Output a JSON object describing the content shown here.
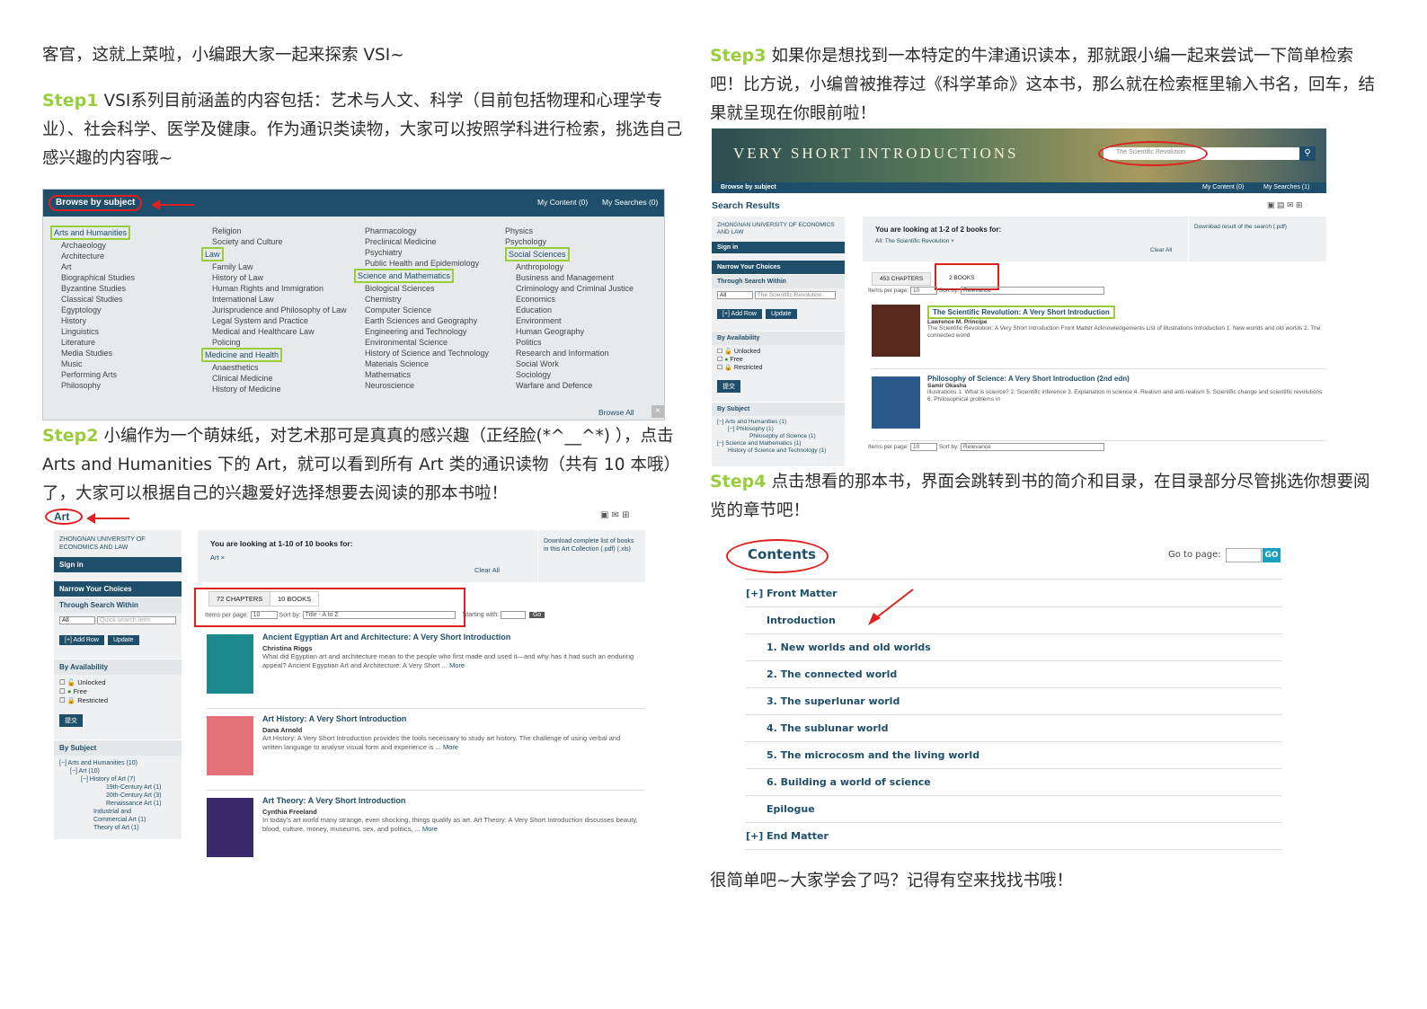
{
  "intro": "客官，这就上菜啦，小编跟大家一起来探索 VSI~",
  "step1": {
    "label": "Step1",
    "text": "VSI系列目前涵盖的内容包括：艺术与人文、科学（目前包括物理和心理学专业）、社会科学、医学及健康。作为通识类读物，大家可以按照学科进行检索，挑选自己感兴趣的内容哦~"
  },
  "step2": {
    "label": "Step2",
    "text": "小编作为一个萌妹纸，对艺术那可是真真的感兴趣（正经脸(*^__^*) ），点击 Arts and Humanities 下的 Art，就可以看到所有 Art 类的通识读物（共有 10 本哦）了，大家可以根据自己的兴趣爱好选择想要去阅读的那本书啦！"
  },
  "step3": {
    "label": "Step3",
    "text": "如果你是想找到一本特定的牛津通识读本，那就跟小编一起来尝试一下简单检索吧！比方说，小编曾被推荐过《科学革命》这本书，那么就在检索框里输入书名，回车，结果就呈现在你眼前啦！"
  },
  "step4": {
    "label": "Step4",
    "text": "点击想看的那本书，界面会跳转到书的简介和目录，在目录部分尽管挑选你想要阅览的章节吧！"
  },
  "outro": "很简单吧~大家学会了吗？记得有空来找找书哦！",
  "browse": {
    "button": "Browse by subject",
    "my_content": "My Content (0)",
    "my_searches": "My Searches (0)",
    "browse_all": "Browse All",
    "columns": [
      [
        "Arts and Humanities",
        "Archaeology",
        "Architecture",
        "Art",
        "Biographical Studies",
        "Byzantine Studies",
        "Classical Studies",
        "Egyptology",
        "History",
        "Linguistics",
        "Literature",
        "Media Studies",
        "Music",
        "Performing Arts",
        "Philosophy"
      ],
      [
        "Religion",
        "Society and Culture",
        "Law",
        "Family Law",
        "History of Law",
        "Human Rights and Immigration",
        "International Law",
        "Jurisprudence and Philosophy of Law",
        "Legal System and Practice",
        "Medical and Healthcare Law",
        "Policing",
        "Medicine and Health",
        "Anaesthetics",
        "Clinical Medicine",
        "History of Medicine"
      ],
      [
        "Pharmacology",
        "Preclinical Medicine",
        "Psychiatry",
        "Public Health and Epidemiology",
        "Science and Mathematics",
        "Biological Sciences",
        "Chemistry",
        "Computer Science",
        "Earth Sciences and Geography",
        "Engineering and Technology",
        "Environmental Science",
        "History of Science and Technology",
        "Materials Science",
        "Mathematics",
        "Neuroscience"
      ],
      [
        "Physics",
        "Psychology",
        "Social Sciences",
        "Anthropology",
        "Business and Management",
        "Criminology and Criminal Justice",
        "Economics",
        "Education",
        "Environment",
        "Human Geography",
        "Politics",
        "Research and Information",
        "Social Work",
        "Sociology",
        "Warfare and Defence"
      ]
    ]
  },
  "art_page": {
    "heading": "Art",
    "institution": "ZHONGNAN UNIVERSITY OF ECONOMICS AND LAW",
    "sign_in": "Sign in",
    "narrow": "Narrow Your Choices",
    "through_search": "Through Search Within",
    "all_option": "All",
    "quick_search_placeholder": "Quick search term",
    "add_row": "[+] Add Row",
    "update": "Update",
    "by_availability": "By Availability",
    "unlocked": "Unlocked",
    "free": "Free",
    "restricted": "Restricted",
    "submit": "提交",
    "by_subject": "By Subject",
    "subject_tree": [
      "[−] Arts and Humanities (10)",
      "[−] Art (10)",
      "[−] History of Art (7)",
      "19th-Century Art (1)",
      "20th-Century Art (3)",
      "Renaissance Art (1)",
      "Industrial and",
      "Commercial Art (1)",
      "Theory of Art (1)"
    ],
    "looking_at": "You are looking at  1-10 of 10 books  for:",
    "filter": "Art  ×",
    "clear_all": "Clear All",
    "download": "Download complete list of books in this Art Collection (.pdf) (.xls)",
    "tab_chapters": "72 CHAPTERS",
    "tab_books": "10 BOOKS",
    "items_per_page_label": "Items per page:",
    "items_per_page": "10",
    "sort_by_label": "Sort by:",
    "sort_by": "Title - A to Z",
    "starting_with": "Starting with:",
    "go": "Go",
    "books": [
      {
        "title": "Ancient Egyptian Art and Architecture: A Very Short Introduction",
        "author": "Christina Riggs",
        "desc": "What did Egyptian art and architecture mean to the people who first made and used it—and why has it had such an enduring appeal? Ancient Egyptian Art and Architecture: A Very Short ...",
        "more": "More",
        "cover": "#1c8a8c"
      },
      {
        "title": "Art History: A Very Short Introduction",
        "author": "Dana Arnold",
        "desc": "Art History: A Very Short Introduction provides the tools necessary to study art history. The challenge of using verbal and written language to analyse visual form and experience is ...",
        "more": "More",
        "cover": "#e4707a"
      },
      {
        "title": "Art Theory: A Very Short Introduction",
        "author": "Cynthia Freeland",
        "desc": "In today's art world many strange, even shocking, things qualify as art. Art Theory: A Very Short Introduction discusses beauty, blood, culture, money, museums, sex, and politics, ...",
        "more": "More",
        "cover": "#3b2a6b"
      }
    ]
  },
  "search_page": {
    "banner": "VERY SHORT INTRODUCTIONS",
    "search_value": "The Scientific Revolution",
    "browse": "Browse by subject",
    "my_content": "My Content (0)",
    "my_searches": "My Searches (1)",
    "results_heading": "Search Results",
    "institution": "ZHONGNAN UNIVERSITY OF ECONOMICS AND LAW",
    "sign_in": "Sign in",
    "narrow": "Narrow Your Choices",
    "through_search": "Through Search Within",
    "all_option": "All",
    "search_within_value": "The Scientific Revolution",
    "add_row": "[+] Add Row",
    "update": "Update",
    "by_availability": "By Availability",
    "unlocked": "Unlocked",
    "free": "Free",
    "restricted": "Restricted",
    "submit": "提交",
    "by_subject": "By Subject",
    "subject_tree": [
      "[−] Arts and Humanities (1)",
      "[−] Philosophy (1)",
      "Philosophy of Science (1)",
      "[−] Science and Mathematics (1)",
      "History of Science and Technology (1)"
    ],
    "looking_at": "You are looking at  1-2 of 2 books  for:",
    "filter": "All: The Scientific Revolution  ×",
    "clear_all": "Clear All",
    "download": "Download result of the search (.pdf)",
    "tab_chapters": "453 CHAPTERS",
    "tab_books": "2 BOOKS",
    "items_per_page_label": "Items per page:",
    "items_per_page": "10",
    "sort_by_label": "Sort by:",
    "sort_by": "Relevance",
    "books": [
      {
        "title": "The Scientific Revolution: A Very Short Introduction",
        "author": "Lawrence M. Principe",
        "desc": "The Scientific Revolution: A Very Short Introduction Front Matter Acknowledgements List of illustrations Introduction 1. New worlds and old worlds 2. The connected world",
        "cover": "#5a2a1e"
      },
      {
        "title": "Philosophy of Science: A Very Short Introduction (2nd edn)",
        "author": "Samir Okasha",
        "desc": "illustrations 1. What is science? 2. Scientific inference 3. Explanation in science 4. Realism and anti-realism 5. Scientific change and scientific revolutions 6. Philosophical problems in",
        "cover": "#2a5a8a"
      }
    ]
  },
  "contents": {
    "heading": "Contents",
    "go_to_page": "Go to page:",
    "go": "GO",
    "items": [
      "[+]  Front Matter",
      "Introduction",
      "1. New worlds and old worlds",
      "2. The connected world",
      "3. The superlunar world",
      "4. The sublunar world",
      "5. The microcosm and the living world",
      "6. Building a world of science",
      "Epilogue",
      "[+]  End Matter"
    ]
  }
}
